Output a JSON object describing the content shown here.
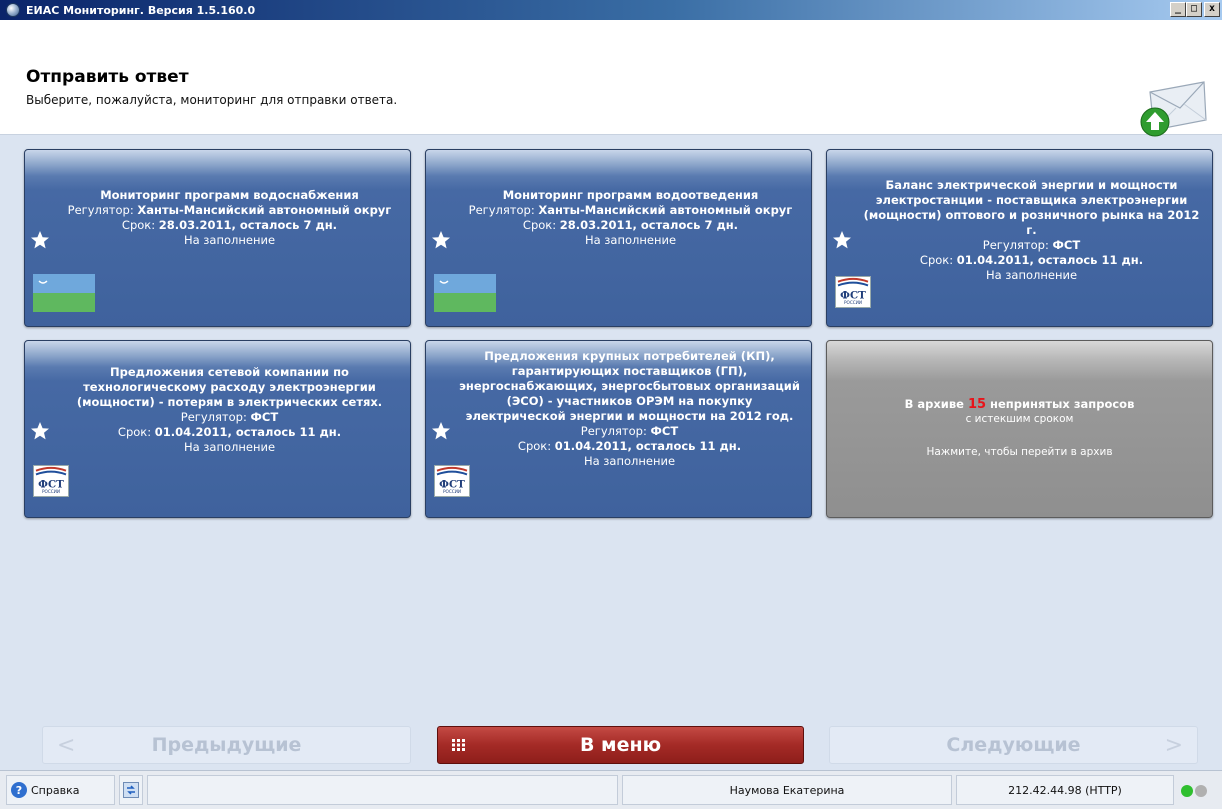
{
  "window": {
    "title": "ЕИАС Мониторинг. Версия 1.5.160.0",
    "buttons": [
      "_",
      "□",
      "x"
    ]
  },
  "header": {
    "title": "Отправить ответ",
    "subtitle": "Выберите, пожалуйста, мониторинг для отправки ответа.",
    "icon": "envelope-upload-icon"
  },
  "cards": [
    {
      "lines": [
        {
          "text": "Мониторинг программ водоснабжения",
          "bold": true
        },
        {
          "parts": [
            {
              "text": "Регулятор: ",
              "bold": false
            },
            {
              "text": "Ханты-Мансийский автономный округ",
              "bold": true
            }
          ]
        },
        {
          "parts": [
            {
              "text": "Срок: ",
              "bold": false
            },
            {
              "text": "28.03.2011, осталось 7 дн.",
              "bold": true
            }
          ]
        },
        {
          "text": "На заполнение",
          "bold": false
        }
      ],
      "icon": "star-icon",
      "logo": "hmao-flag"
    },
    {
      "lines": [
        {
          "text": "Мониторинг программ водоотведения",
          "bold": true
        },
        {
          "parts": [
            {
              "text": "Регулятор: ",
              "bold": false
            },
            {
              "text": "Ханты-Мансийский автономный округ",
              "bold": true
            }
          ]
        },
        {
          "parts": [
            {
              "text": "Срок: ",
              "bold": false
            },
            {
              "text": "28.03.2011, осталось 7 дн.",
              "bold": true
            }
          ]
        },
        {
          "text": "На заполнение",
          "bold": false
        }
      ],
      "icon": "star-icon",
      "logo": "hmao-flag"
    },
    {
      "lines": [
        {
          "text": "Баланс электрической энергии и мощности электростанции - поставщика электроэнергии (мощности) оптового и розничного рынка на 2012 г.",
          "bold": true
        },
        {
          "parts": [
            {
              "text": "Регулятор: ",
              "bold": false
            },
            {
              "text": "ФСТ",
              "bold": true
            }
          ]
        },
        {
          "parts": [
            {
              "text": "Срок: ",
              "bold": false
            },
            {
              "text": "01.04.2011, осталось 11 дн.",
              "bold": true
            }
          ]
        },
        {
          "text": "На заполнение",
          "bold": false
        }
      ],
      "icon": "star-icon",
      "logo": "fst-logo"
    },
    {
      "lines": [
        {
          "text": "Предложения сетевой компании по технологическому расходу электроэнергии (мощности) - потерям в электрических сетях.",
          "bold": true
        },
        {
          "parts": [
            {
              "text": "Регулятор: ",
              "bold": false
            },
            {
              "text": "ФСТ",
              "bold": true
            }
          ]
        },
        {
          "parts": [
            {
              "text": "Срок: ",
              "bold": false
            },
            {
              "text": "01.04.2011, осталось 11 дн.",
              "bold": true
            }
          ]
        },
        {
          "text": "На заполнение",
          "bold": false
        }
      ],
      "icon": "star-icon",
      "logo": "fst-logo"
    },
    {
      "lines": [
        {
          "text": "Предложения крупных потребителей (КП), гарантирующих поставщиков (ГП), энергоснабжающих, энергосбытовых организаций (ЭСО) - участников ОРЭМ на покупку электрической энергии и мощности на 2012 год.",
          "bold": true
        },
        {
          "parts": [
            {
              "text": "Регулятор: ",
              "bold": false
            },
            {
              "text": "ФСТ",
              "bold": true
            }
          ]
        },
        {
          "parts": [
            {
              "text": "Срок: ",
              "bold": false
            },
            {
              "text": "01.04.2011, осталось 11 дн.",
              "bold": true
            }
          ]
        },
        {
          "text": "На заполнение",
          "bold": false
        }
      ],
      "icon": "star-icon",
      "logo": "fst-logo"
    }
  ],
  "archive": {
    "prefix": "В архиве ",
    "count": "15",
    "suffix": " непринятых запросов",
    "sub": "с истекшим сроком",
    "hint": "Нажмите, чтобы перейти в архив",
    "count_color": "#e8141a"
  },
  "nav": {
    "prev": "Предыдущие",
    "menu": "В меню",
    "next": "Следующие",
    "prev_arrow": "<",
    "next_arrow": ">"
  },
  "status": {
    "help": "Справка",
    "user": "Наумова Екатерина",
    "connection": "212.42.44.98 (HTTP)",
    "indicator_colors": [
      "#2fbf2f",
      "#b0b0b0"
    ]
  },
  "fst_text": "ФСТ",
  "fst_sub": "РОССИИ"
}
